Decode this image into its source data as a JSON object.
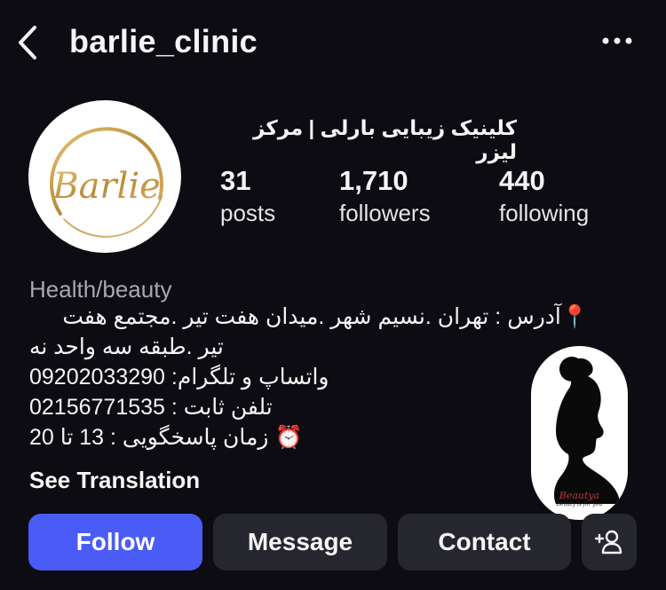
{
  "header": {
    "back_icon": "chevron-left-icon",
    "username": "barlie_clinic",
    "more_icon": "more-horizontal-icon"
  },
  "profile": {
    "avatar_logo_text": "Barlie",
    "display_name": "کلینیک زیبایی بارلی | مرکز لیزر",
    "stats": [
      {
        "value": "31",
        "label": "posts"
      },
      {
        "value": "1,710",
        "label": "followers"
      },
      {
        "value": "440",
        "label": "following"
      }
    ],
    "category": "Health/beauty",
    "bio_lines": [
      "📍آدرس : تهران .نسیم شهر .میدان هفت تیر .مجتمع هفت",
      "تیر .طبقه سه واحد نه",
      "واتساپ و تلگرام: 09202033290",
      "تلفن ثابت : 02156771535",
      "⏰ زمان پاسخگویی : 13 تا 20"
    ],
    "see_translation": "See Translation"
  },
  "sticker": {
    "title": "Beautya",
    "subtitle": "Beauty is for you"
  },
  "actions": {
    "follow": "Follow",
    "message": "Message",
    "contact": "Contact",
    "add_person_icon": "add-person-icon"
  },
  "colors": {
    "background": "#0c0c12",
    "follow_button": "#4a5cf5",
    "secondary_button": "#26262f",
    "gold": "#c9a052",
    "muted_text": "#a8a8b0"
  }
}
